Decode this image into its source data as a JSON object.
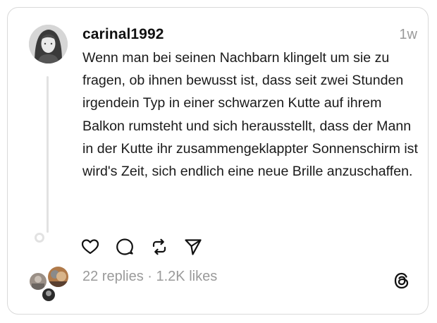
{
  "post": {
    "username": "carinal1992",
    "time": "1w",
    "text": "Wenn man bei seinen Nachbarn klingelt um sie zu fragen, ob ihnen bewusst ist, dass seit zwei Stunden irgendein Typ in einer schwarzen Kutte auf ihrem Balkon rumsteht und sich herausstellt, dass der Mann in der Kutte ihr zusammengeklappter Sonnenschirm ist wird's Zeit, sich endlich eine neue Brille anzuschaffen.",
    "stats": "22 replies · 1.2K likes"
  },
  "icons": {
    "like": "heart-icon",
    "reply": "comment-bubble-icon",
    "repost": "repost-arrows-icon",
    "share": "send-paper-plane-icon",
    "brand": "threads-logo-icon"
  },
  "colors": {
    "text": "#1a1a1a",
    "muted": "#9a9a9a",
    "border": "#d9d9d9"
  }
}
